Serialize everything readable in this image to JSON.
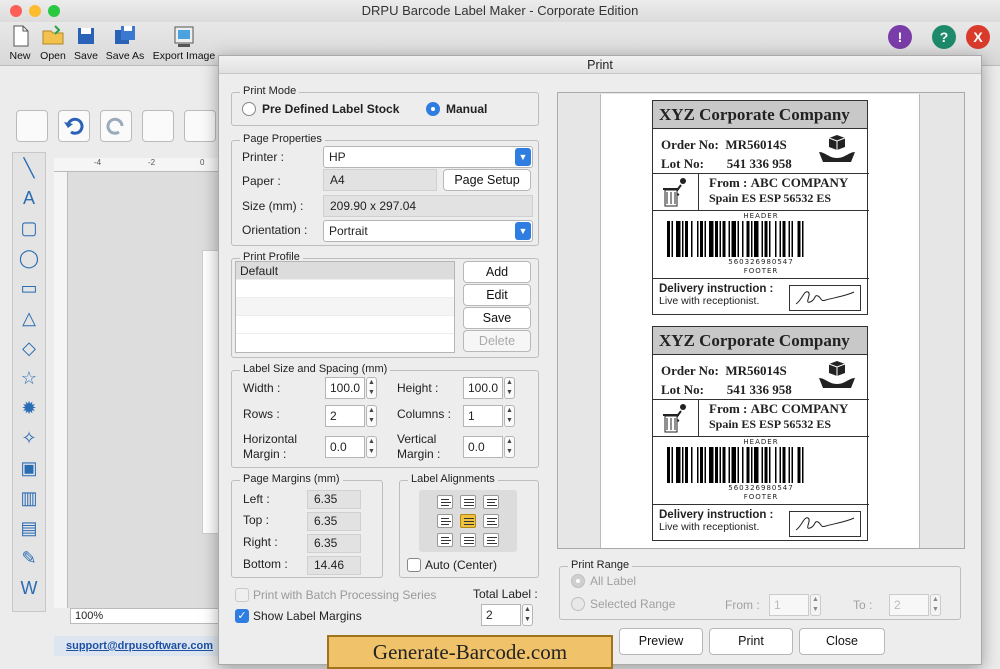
{
  "app": {
    "title": "DRPU Barcode Label Maker - Corporate Edition",
    "traffic_colors": [
      "#fc5f57",
      "#fdbc2e",
      "#28c840"
    ]
  },
  "toolbar": {
    "items": [
      {
        "label": "New",
        "icon": "new-file-icon"
      },
      {
        "label": "Open",
        "icon": "open-folder-icon"
      },
      {
        "label": "Save",
        "icon": "save-icon"
      },
      {
        "label": "Save As",
        "icon": "save-as-icon"
      },
      {
        "label": "Export Image",
        "icon": "export-image-icon"
      }
    ],
    "right": [
      {
        "glyph": "!",
        "color": "#7a3ca8",
        "icon": "about-icon"
      },
      {
        "glyph": "?",
        "color": "#1d8a6b",
        "icon": "help-icon"
      },
      {
        "glyph": "X",
        "color": "#d93a2c",
        "icon": "exit-icon"
      }
    ]
  },
  "canvas": {
    "ruler_ticks": [
      "-4",
      "-2",
      "0"
    ],
    "zoom": "100%",
    "support_email": "support@drpusoftware.com"
  },
  "dialog": {
    "title": "Print",
    "print_mode": {
      "label": "Print Mode",
      "options": [
        "Pre Defined Label Stock",
        "Manual"
      ],
      "selected": "Manual"
    },
    "page_properties": {
      "label": "Page Properties",
      "printer_label": "Printer :",
      "printer_value": "HP",
      "paper_label": "Paper :",
      "paper_value": "A4",
      "page_setup": "Page Setup",
      "size_label": "Size (mm) :",
      "size_value": "209.90 x 297.04",
      "orientation_label": "Orientation :",
      "orientation_value": "Portrait"
    },
    "print_profile": {
      "label": "Print Profile",
      "items": [
        "Default"
      ],
      "buttons": {
        "add": "Add",
        "edit": "Edit",
        "save": "Save",
        "delete": "Delete"
      }
    },
    "label_size": {
      "label": "Label Size and Spacing (mm)",
      "width_label": "Width :",
      "width": "100.0",
      "height_label": "Height :",
      "height": "100.0",
      "rows_label": "Rows :",
      "rows": "2",
      "columns_label": "Columns :",
      "columns": "1",
      "hmargin_label_1": "Horizontal",
      "hmargin_label_2": "Margin :",
      "hmargin": "0.0",
      "vmargin_label_1": "Vertical",
      "vmargin_label_2": "Margin :",
      "vmargin": "0.0"
    },
    "page_margins": {
      "label": "Page Margins (mm)",
      "left_label": "Left :",
      "left": "6.35",
      "top_label": "Top :",
      "top": "6.35",
      "right_label": "Right :",
      "right": "6.35",
      "bottom_label": "Bottom :",
      "bottom": "14.46"
    },
    "label_alignments": {
      "label": "Label Alignments",
      "selected_index": 4,
      "auto_center": "Auto (Center)",
      "auto_checked": false
    },
    "batch": {
      "label": "Print with Batch Processing Series",
      "checked": false
    },
    "show_margins": {
      "label": "Show Label Margins",
      "checked": true
    },
    "total_label": {
      "label": "Total Label :",
      "value": "2"
    },
    "print_range": {
      "label": "Print Range",
      "all": "All Label",
      "selected": "Selected Range",
      "from_label": "From :",
      "from": "1",
      "to_label": "To :",
      "to": "2"
    },
    "buttons": {
      "preview": "Preview",
      "print": "Print",
      "close": "Close"
    },
    "watermark": "Generate-Barcode.com",
    "preview_label": {
      "company": "XYZ Corporate Company",
      "order_label": "Order No:",
      "order": "MR56014S",
      "lot_label": "Lot No:",
      "lot": "541 336 958",
      "from_label": "From :",
      "from_name": "ABC COMPANY",
      "address": "Spain ES ESP 56532 ES",
      "header": "HEADER",
      "barcode_digits": "560326980547",
      "footer": "FOOTER",
      "delivery_title": "Delivery instruction :",
      "delivery_text": "Live with receptionist."
    }
  }
}
